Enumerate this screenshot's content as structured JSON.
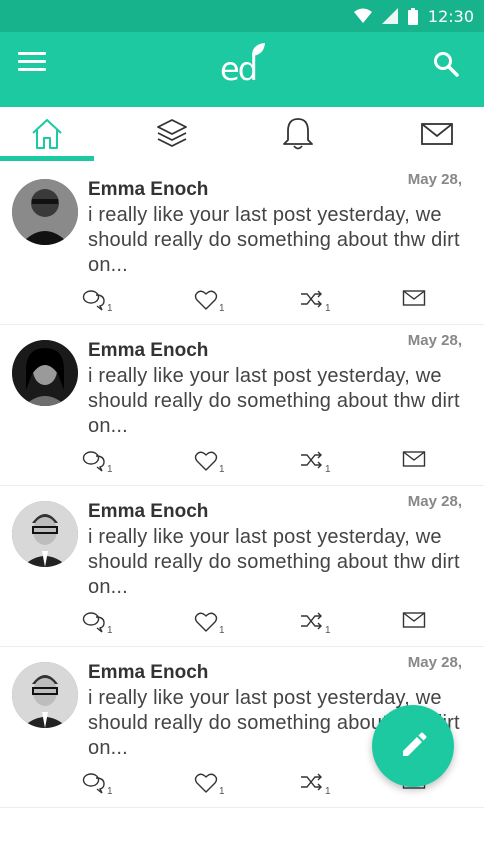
{
  "status_bar": {
    "time": "12:30",
    "icons": [
      "wifi-icon",
      "signal-icon",
      "battery-icon"
    ]
  },
  "app_bar": {
    "logo_text": "ed",
    "icons": [
      "menu-icon",
      "search-icon"
    ]
  },
  "tabs": [
    {
      "name": "home",
      "icon": "home-icon",
      "active": true
    },
    {
      "name": "layers",
      "icon": "layers-icon",
      "active": false
    },
    {
      "name": "notifications",
      "icon": "bell-icon",
      "active": false
    },
    {
      "name": "messages",
      "icon": "mail-icon",
      "active": false
    }
  ],
  "colors": {
    "accent": "#1dc9a0",
    "status_bar": "#17b38d"
  },
  "posts": [
    {
      "author": "Emma Enoch",
      "date": "May 28,",
      "text": "i really like your last post yesterday, we should really do something about thw dirt on...",
      "comments": "1",
      "likes": "1",
      "shares": "1"
    },
    {
      "author": "Emma Enoch",
      "date": "May 28,",
      "text": "i really like your last post yesterday, we should really do something about thw dirt on...",
      "comments": "1",
      "likes": "1",
      "shares": "1"
    },
    {
      "author": "Emma Enoch",
      "date": "May 28,",
      "text": "i really like your last post yesterday, we should really do something about thw dirt on...",
      "comments": "1",
      "likes": "1",
      "shares": "1"
    },
    {
      "author": "Emma Enoch",
      "date": "May 28,",
      "text": "i really like your last post yesterday, we should really do something about thw dirt on...",
      "comments": "1",
      "likes": "1",
      "shares": "1"
    }
  ],
  "fab": {
    "icon": "pencil-icon"
  }
}
